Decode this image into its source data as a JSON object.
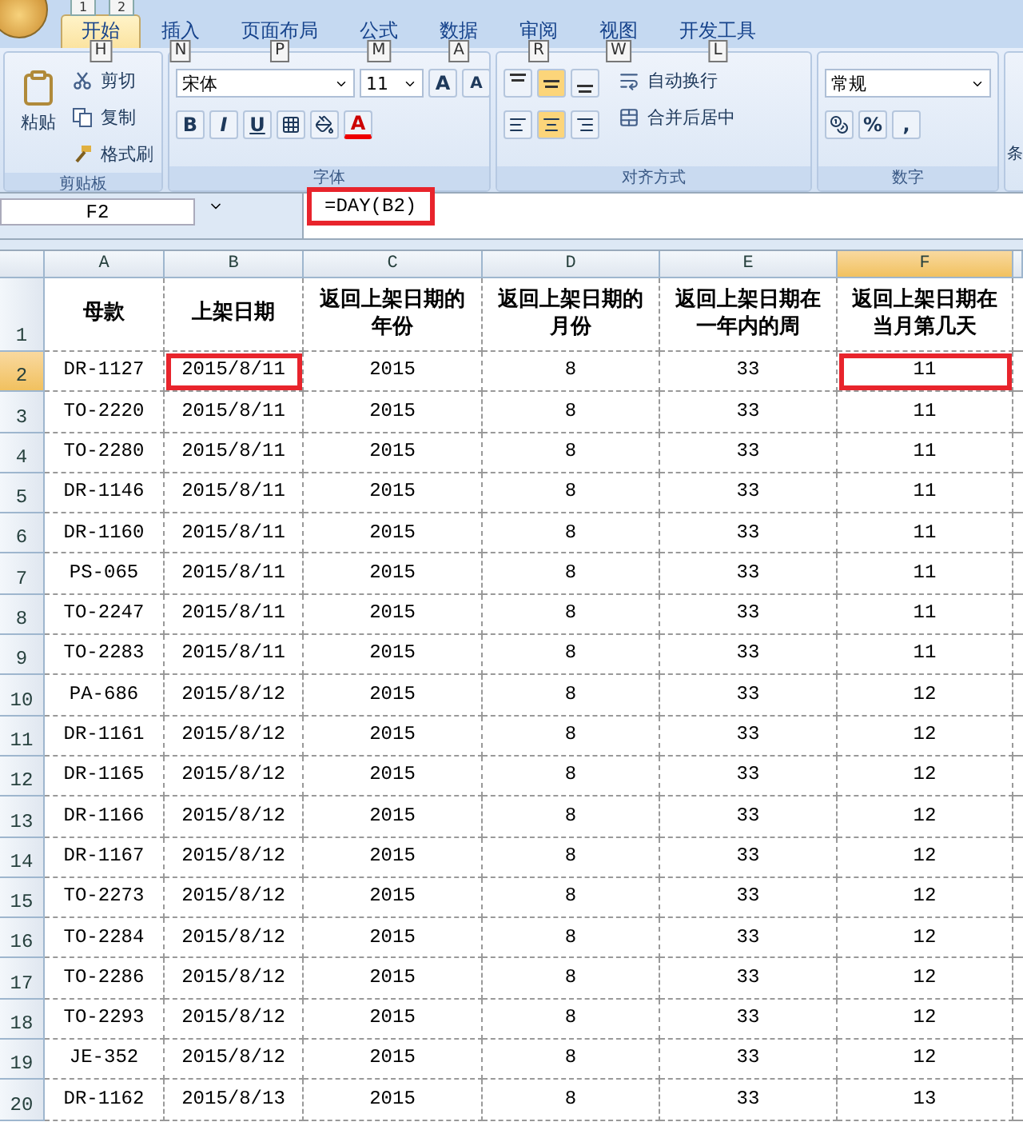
{
  "quick_access": [
    "1",
    "2"
  ],
  "tabs": [
    {
      "label": "开始",
      "key": "H",
      "selected": true
    },
    {
      "label": "插入",
      "key": "N",
      "selected": false
    },
    {
      "label": "页面布局",
      "key": "P",
      "selected": false
    },
    {
      "label": "公式",
      "key": "M",
      "selected": false
    },
    {
      "label": "数据",
      "key": "A",
      "selected": false
    },
    {
      "label": "审阅",
      "key": "R",
      "selected": false
    },
    {
      "label": "视图",
      "key": "W",
      "selected": false
    },
    {
      "label": "开发工具",
      "key": "L",
      "selected": false
    }
  ],
  "clipboard": {
    "paste": "粘贴",
    "items": [
      {
        "kind": "cut",
        "label": "剪切"
      },
      {
        "kind": "copy",
        "label": "复制"
      },
      {
        "kind": "brush",
        "label": "格式刷"
      }
    ],
    "label": "剪贴板"
  },
  "font": {
    "name": "宋体",
    "size": "11",
    "grow": "A",
    "shrink": "A",
    "styles": [
      "B",
      "I",
      "U"
    ],
    "font_color": "A",
    "label": "字体"
  },
  "alignment": {
    "vertical": [
      {
        "kind": "top",
        "selected": false
      },
      {
        "kind": "middle",
        "selected": true
      },
      {
        "kind": "bottom",
        "selected": false
      }
    ],
    "horizontal": [
      {
        "kind": "left",
        "selected": false
      },
      {
        "kind": "center",
        "selected": true
      },
      {
        "kind": "right",
        "selected": false
      }
    ],
    "wrap": "自动换行",
    "merge": "合并后居中",
    "label": "对齐方式"
  },
  "number": {
    "format": "常规",
    "symbols": [
      "%",
      ","
    ],
    "label": "数字"
  },
  "styles_cut": "条",
  "name_box": "F2",
  "formula": {
    "text": "=DAY(B2)",
    "highlighted": true
  },
  "columns": [
    {
      "letter": "A",
      "selected": false
    },
    {
      "letter": "B",
      "selected": false
    },
    {
      "letter": "C",
      "selected": false
    },
    {
      "letter": "D",
      "selected": false
    },
    {
      "letter": "E",
      "selected": false
    },
    {
      "letter": "F",
      "selected": true
    }
  ],
  "header_row": {
    "number": "1",
    "cells": [
      "母款",
      "上架日期",
      "返回上架日期的年份",
      "返回上架日期的月份",
      "返回上架日期在一年内的周",
      "返回上架日期在当月第几天"
    ]
  },
  "rows": [
    {
      "number": "2",
      "selected": true,
      "marked": [
        false,
        true,
        false,
        false,
        false,
        true
      ],
      "cells": [
        "DR-1127",
        "2015/8/11",
        "2015",
        "8",
        "33",
        "11"
      ]
    },
    {
      "number": "3",
      "selected": false,
      "cells": [
        "TO-2220",
        "2015/8/11",
        "2015",
        "8",
        "33",
        "11"
      ]
    },
    {
      "number": "4",
      "selected": false,
      "cells": [
        "TO-2280",
        "2015/8/11",
        "2015",
        "8",
        "33",
        "11"
      ]
    },
    {
      "number": "5",
      "selected": false,
      "cells": [
        "DR-1146",
        "2015/8/11",
        "2015",
        "8",
        "33",
        "11"
      ]
    },
    {
      "number": "6",
      "selected": false,
      "cells": [
        "DR-1160",
        "2015/8/11",
        "2015",
        "8",
        "33",
        "11"
      ]
    },
    {
      "number": "7",
      "selected": false,
      "cells": [
        "PS-065",
        "2015/8/11",
        "2015",
        "8",
        "33",
        "11"
      ]
    },
    {
      "number": "8",
      "selected": false,
      "cells": [
        "TO-2247",
        "2015/8/11",
        "2015",
        "8",
        "33",
        "11"
      ]
    },
    {
      "number": "9",
      "selected": false,
      "cells": [
        "TO-2283",
        "2015/8/11",
        "2015",
        "8",
        "33",
        "11"
      ]
    },
    {
      "number": "10",
      "selected": false,
      "cells": [
        "PA-686",
        "2015/8/12",
        "2015",
        "8",
        "33",
        "12"
      ]
    },
    {
      "number": "11",
      "selected": false,
      "cells": [
        "DR-1161",
        "2015/8/12",
        "2015",
        "8",
        "33",
        "12"
      ]
    },
    {
      "number": "12",
      "selected": false,
      "cells": [
        "DR-1165",
        "2015/8/12",
        "2015",
        "8",
        "33",
        "12"
      ]
    },
    {
      "number": "13",
      "selected": false,
      "cells": [
        "DR-1166",
        "2015/8/12",
        "2015",
        "8",
        "33",
        "12"
      ]
    },
    {
      "number": "14",
      "selected": false,
      "cells": [
        "DR-1167",
        "2015/8/12",
        "2015",
        "8",
        "33",
        "12"
      ]
    },
    {
      "number": "15",
      "selected": false,
      "cells": [
        "TO-2273",
        "2015/8/12",
        "2015",
        "8",
        "33",
        "12"
      ]
    },
    {
      "number": "16",
      "selected": false,
      "cells": [
        "TO-2284",
        "2015/8/12",
        "2015",
        "8",
        "33",
        "12"
      ]
    },
    {
      "number": "17",
      "selected": false,
      "cells": [
        "TO-2286",
        "2015/8/12",
        "2015",
        "8",
        "33",
        "12"
      ]
    },
    {
      "number": "18",
      "selected": false,
      "cells": [
        "TO-2293",
        "2015/8/12",
        "2015",
        "8",
        "33",
        "12"
      ]
    },
    {
      "number": "19",
      "selected": false,
      "cells": [
        "JE-352",
        "2015/8/12",
        "2015",
        "8",
        "33",
        "12"
      ]
    },
    {
      "number": "20",
      "selected": false,
      "cells": [
        "DR-1162",
        "2015/8/13",
        "2015",
        "8",
        "33",
        "13"
      ]
    }
  ]
}
